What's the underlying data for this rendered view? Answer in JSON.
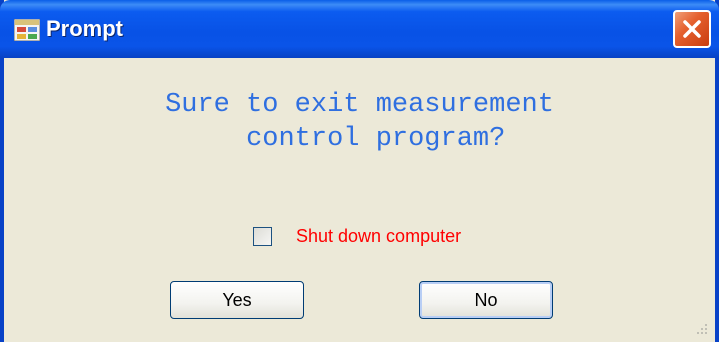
{
  "window": {
    "title": "Prompt",
    "app_icon": "application-icon",
    "close_icon": "close-icon"
  },
  "dialog": {
    "message": "Sure to exit measurement\n  control program?",
    "checkbox_label": "Shut down computer",
    "checkbox_checked": false,
    "yes_label": "Yes",
    "no_label": "No"
  },
  "colors": {
    "message": "#2f6fe0",
    "checkbox_label": "#ff0000",
    "titlebar": "#0852e6",
    "close_button": "#e5602e"
  }
}
